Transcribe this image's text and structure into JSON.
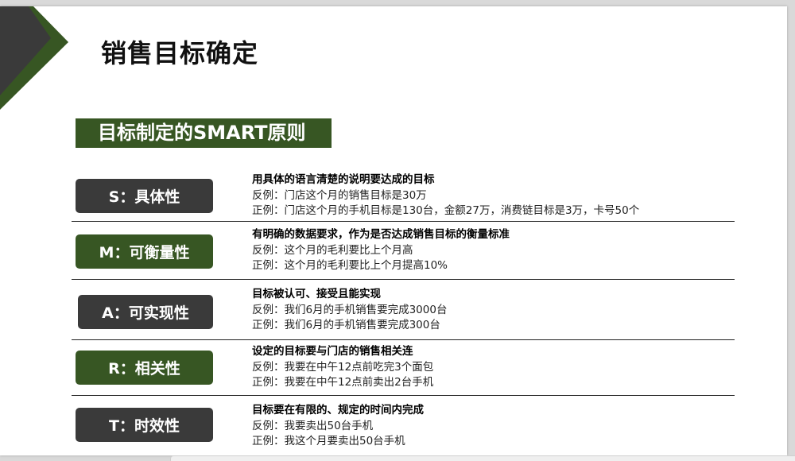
{
  "title": "销售目标确定",
  "subtitle": "目标制定的SMART原则",
  "colors": {
    "green": "#375623",
    "dark": "#3a3a3a"
  },
  "rows": [
    {
      "label": "S：具体性",
      "head": "用具体的语言清楚的说明要达成的目标",
      "line1": "反例：门店这个月的销售目标是30万",
      "line2": "正例：门店这个月的手机目标是130台，金额27万，消费链目标是3万，卡号50个"
    },
    {
      "label": "M：可衡量性",
      "head": "有明确的数据要求，作为是否达成销售目标的衡量标准",
      "line1": "反例：这个月的毛利要比上个月高",
      "line2": "正例：这个月的毛利要比上个月提高10%"
    },
    {
      "label": "A：可实现性",
      "head": "目标被认可、接受且能实现",
      "line1": "反例：我们6月的手机销售要完成3000台",
      "line2": "正例：我们6月的手机销售要完成300台"
    },
    {
      "label": "R：相关性",
      "head": "设定的目标要与门店的销售相关连",
      "line1": "反例：我要在中午12点前吃完3个面包",
      "line2": "正例：我要在中午12点前卖出2台手机"
    },
    {
      "label": "T：时效性",
      "head": "目标要在有限的、规定的时间内完成",
      "line1": "反例：我要卖出50台手机",
      "line2": "正例：我这个月要卖出50台手机"
    }
  ]
}
